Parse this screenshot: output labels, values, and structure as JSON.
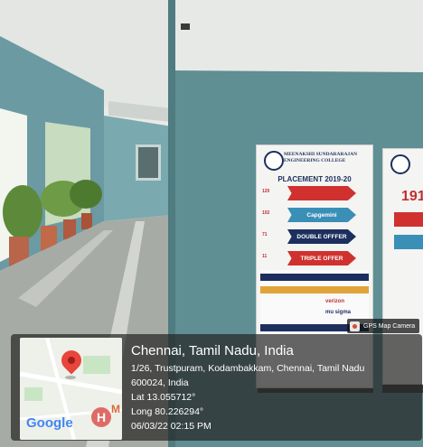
{
  "photo": {
    "description_icons": [
      "map-pin-icon",
      "hospital-icon",
      "camera-icon"
    ]
  },
  "banner_left": {
    "college": "MEENAKSHI SUNDARARAJAN ENGINEERING COLLEGE",
    "heading": "PLACEMENT 2019-20",
    "rows": [
      {
        "count": "120",
        "label": ""
      },
      {
        "count": "102",
        "label": "Capgemini"
      },
      {
        "count": "71",
        "label": "DOUBLE OFFFER"
      },
      {
        "count": "11",
        "label": "TRIPLE OFFER"
      }
    ],
    "recruiters": [
      "verizon",
      "mu sigma"
    ]
  },
  "banner_right": {
    "number": "191"
  },
  "badge": {
    "label": "GPS Map Camera"
  },
  "location": {
    "city": "Chennai, Tamil Nadu, India",
    "address_line1": "1/26, Trustpuram, Kodambakkam, Chennai, Tamil Nadu",
    "address_line2": "600024, India",
    "lat": "Lat 13.055712°",
    "long": "Long 80.226294°",
    "datetime": "06/03/22 02:15 PM"
  },
  "map": {
    "brand": "Google",
    "marker_letter": "H",
    "marker_text": "M"
  }
}
